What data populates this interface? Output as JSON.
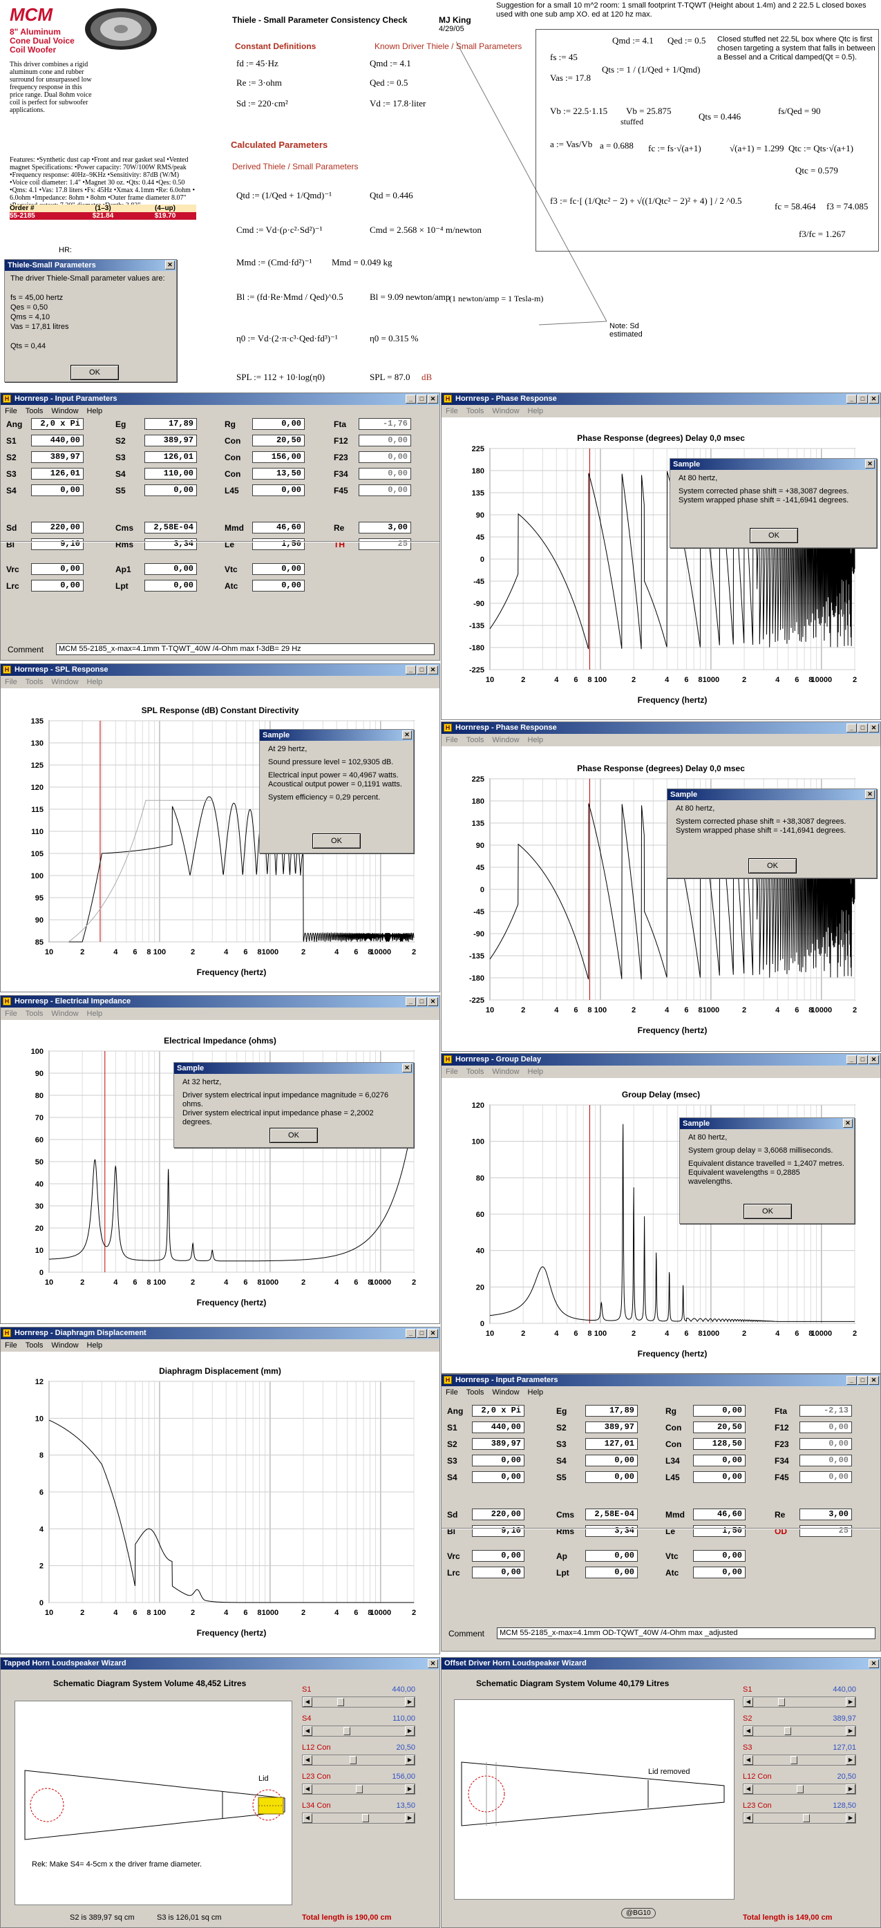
{
  "product": {
    "logo": "MCM",
    "title": "8\" Aluminum Cone Dual Voice Coil Woofer",
    "desc": "This driver combines a rigid aluminum cone and rubber surround for unsurpassed low frequency response in this price range. Dual 8ohm voice coil is perfect for subwoofer applications.",
    "features": "Features: •Synthetic dust cap •Front and rear gasket seal •Vented magnet Specifications: •Power capacity: 70W/100W RMS/peak •Frequency response: 40Hz–9KHz •Sensitivity: 87dB (W/M) •Voice coil diameter: 1.4\" •Magnet 30 oz. •Qts: 0.44 •Qes: 0.50 •Qms: 4.1 •Vas: 17.8 liters •Fs: 45Hz •Xmax 4.1mm •Re: 6.0ohm • 6.0ohm •Impedance: 8ohm • 8ohm •Outer frame diameter 8.07\" •Required cutout: 7.20\" diameter •Depth: 3.82\"",
    "table_headers": [
      "Order #",
      "(1–3)",
      "(4–up)"
    ],
    "table_row": [
      "55-2185",
      "$21.84",
      "$19.70"
    ],
    "hr": "HR:"
  },
  "ts_dialog": {
    "title": "Thiele-Small Parameters",
    "lines": [
      "The driver Thiele-Small parameter values are:",
      "fs = 45,00 hertz",
      "Qes = 0,50",
      "Qms = 4,10",
      "Vas = 17,81 litres",
      "Qts = 0,44"
    ],
    "ok": "OK"
  },
  "calc": {
    "title": "Thiele - Small Parameter Consistency Check",
    "author": "MJ King",
    "date": "4/29/05",
    "const_h": "Constant Definitions",
    "known_h": "Known Driver Thiele / Small Parameters",
    "const": [
      "fd := 45·Hz",
      "Re := 3·ohm",
      "Sd := 220·cm²"
    ],
    "known": [
      "Qmd := 4.1",
      "Qed := 0.5",
      "Vd := 17.8·liter"
    ],
    "calc_h": "Calculated Parameters",
    "derived_h": "Derived Thiele / Small Parameters",
    "f_qtd": "Qtd := (1/Qed + 1/Qmd)⁻¹",
    "r_qtd": "Qtd = 0.446",
    "f_cmd": "Cmd := Vd·(ρ·c²·Sd²)⁻¹",
    "r_cmd": "Cmd = 2.568 × 10⁻⁴ m/newton",
    "f_mmd": "Mmd := (Cmd·fd²)⁻¹",
    "r_mmd": "Mmd = 0.049 kg",
    "f_bl": "Bl := (fd·Re·Mmd / Qed)^0.5",
    "r_bl": "Bl = 9.09 newton/amp",
    "n_bl": "(1 newton/amp = 1 Tesla-m)",
    "f_eta": "η0 := Vd·(2·π·c³·Qed·fd³)⁻¹",
    "r_eta": "η0 = 0.315 %",
    "f_spl": "SPL := 112 + 10·log(η0)",
    "r_spl": "SPL = 87.0",
    "u_spl": "dB",
    "note": "Note: Sd estimated"
  },
  "suggest": {
    "text": "Suggestion for a small 10 m^2 room: 1 small footprint T-TQWT (Height about 1.4m) and 2 22.5 L closed boxes used with one sub amp XO. ed at 120 hz max.",
    "box_text": "Closed stuffed net 22.5L box where Qtc is first chosen targeting a system that falls in between a Bessel and a Critical damped(Qt = 0.5).",
    "eqs": [
      "Qmd := 4.1",
      "Qed := 0.5",
      "fs := 45",
      "Vas := 17.8",
      "Qts := 1 / (1/Qed + 1/Qmd)",
      "Vb := 22.5·1.15",
      "Vb = 25.875",
      "stuffed",
      "Qts = 0.446",
      "fs/Qed = 90",
      "a := Vas/Vb",
      "a = 0.688",
      "fc := fs·√(a+1)",
      "√(a+1) = 1.299",
      "Qtc := Qts·√(a+1)",
      "Qtc = 0.579",
      "f3 := fc·[ (1/Qtc² − 2) + √((1/Qtc² − 2)² + 4) ] / 2 ^0.5",
      "fc = 58.464",
      "f3 = 74.085",
      "f3/fc = 1.267"
    ]
  },
  "input1": {
    "title": "Hornresp - Input Parameters",
    "menu": [
      "File",
      "Tools",
      "Window",
      "Help"
    ],
    "rows": [
      [
        [
          "Ang",
          "2,0 x Pi"
        ],
        [
          "Eg",
          "17,89"
        ],
        [
          "Rg",
          "0,00"
        ],
        [
          "Fta",
          "-1,76"
        ]
      ],
      [
        [
          "S1",
          "440,00"
        ],
        [
          "S2",
          "389,97"
        ],
        [
          "Con",
          "20,50"
        ],
        [
          "F12",
          "0,00"
        ]
      ],
      [
        [
          "S2",
          "389,97"
        ],
        [
          "S3",
          "126,01"
        ],
        [
          "Con",
          "156,00"
        ],
        [
          "F23",
          "0,00"
        ]
      ],
      [
        [
          "S3",
          "126,01"
        ],
        [
          "S4",
          "110,00"
        ],
        [
          "Con",
          "13,50"
        ],
        [
          "F34",
          "0,00"
        ]
      ],
      [
        [
          "S4",
          "0,00"
        ],
        [
          "S5",
          "0,00"
        ],
        [
          "L45",
          "0,00"
        ],
        [
          "F45",
          "0,00"
        ]
      ],
      [
        [
          "Sd",
          "220,00"
        ],
        [
          "Cms",
          "2,58E-04"
        ],
        [
          "Mmd",
          "46,60"
        ],
        [
          "Re",
          "3,00"
        ]
      ],
      [
        [
          "Bl",
          "9,10"
        ],
        [
          "Rms",
          "3,34"
        ],
        [
          "Le",
          "1,50"
        ],
        [
          "TH",
          "25"
        ]
      ],
      [
        [
          "Vrc",
          "0,00"
        ],
        [
          "Ap1",
          "0,00"
        ],
        [
          "Vtc",
          "0,00"
        ]
      ],
      [
        [
          "Lrc",
          "0,00"
        ],
        [
          "Lpt",
          "0,00"
        ],
        [
          "Atc",
          "0,00"
        ]
      ]
    ],
    "comment_label": "Comment",
    "comment": "MCM 55-2185_x-max=4.1mm T-TQWT_40W /4-Ohm max f-3dB= 29 Hz"
  },
  "input2": {
    "title": "Hornresp - Input Parameters",
    "menu": [
      "File",
      "Tools",
      "Window",
      "Help"
    ],
    "rows": [
      [
        [
          "Ang",
          "2,0 x Pi"
        ],
        [
          "Eg",
          "17,89"
        ],
        [
          "Rg",
          "0,00"
        ],
        [
          "Fta",
          "-2,13"
        ]
      ],
      [
        [
          "S1",
          "440,00"
        ],
        [
          "S2",
          "389,97"
        ],
        [
          "Con",
          "20,50"
        ],
        [
          "F12",
          "0,00"
        ]
      ],
      [
        [
          "S2",
          "389,97"
        ],
        [
          "S3",
          "127,01"
        ],
        [
          "Con",
          "128,50"
        ],
        [
          "F23",
          "0,00"
        ]
      ],
      [
        [
          "S3",
          "0,00"
        ],
        [
          "S4",
          "0,00"
        ],
        [
          "L34",
          "0,00"
        ],
        [
          "F34",
          "0,00"
        ]
      ],
      [
        [
          "S4",
          "0,00"
        ],
        [
          "S5",
          "0,00"
        ],
        [
          "L45",
          "0,00"
        ],
        [
          "F45",
          "0,00"
        ]
      ],
      [
        [
          "Sd",
          "220,00"
        ],
        [
          "Cms",
          "2,58E-04"
        ],
        [
          "Mmd",
          "46,60"
        ],
        [
          "Re",
          "3,00"
        ]
      ],
      [
        [
          "Bl",
          "9,10"
        ],
        [
          "Rms",
          "3,34"
        ],
        [
          "Le",
          "1,50"
        ],
        [
          "OD",
          "25"
        ]
      ],
      [
        [
          "Vrc",
          "0,00"
        ],
        [
          "Ap",
          "0,00"
        ],
        [
          "Vtc",
          "0,00"
        ]
      ],
      [
        [
          "Lrc",
          "0,00"
        ],
        [
          "Lpt",
          "0,00"
        ],
        [
          "Atc",
          "0,00"
        ]
      ]
    ],
    "comment_label": "Comment",
    "comment": "MCM 55-2185_x-max=4.1mm OD-TQWT_40W /4-Ohm max _adjusted"
  },
  "phase1": {
    "title": "Hornresp - Phase Response",
    "menu": [
      "File",
      "Tools",
      "Window",
      "Help"
    ],
    "plot_title": "Phase Response (degrees)   Delay 0,0 msec",
    "dlg_title": "Sample",
    "dlg": [
      "At 80 hertz,",
      "System corrected phase shift = +38,3087 degrees.",
      "System wrapped phase shift = -141,6941 degrees."
    ],
    "ok": "OK"
  },
  "phase2": {
    "title": "Hornresp - Phase Response",
    "menu": [
      "File",
      "Tools",
      "Window",
      "Help"
    ],
    "plot_title": "Phase Response (degrees)   Delay 0,0 msec",
    "dlg_title": "Sample",
    "dlg": [
      "At 80 hertz,",
      "System corrected phase shift = +38,3087 degrees.",
      "System wrapped phase shift = -141,6941 degrees."
    ],
    "ok": "OK"
  },
  "spl": {
    "title": "Hornresp - SPL Response",
    "menu": [
      "File",
      "Tools",
      "Window",
      "Help"
    ],
    "plot_title": "SPL Response (dB)   Constant Directivity",
    "dlg_title": "Sample",
    "dlg": [
      "At 29 hertz,",
      "Sound pressure level = 102,9305 dB.",
      "Electrical input power = 40,4967 watts.",
      "Acoustical output power = 0,1191 watts.",
      "System efficiency = 0,29 percent."
    ],
    "ok": "OK"
  },
  "imp": {
    "title": "Hornresp - Electrical Impedance",
    "menu": [
      "File",
      "Tools",
      "Window",
      "Help"
    ],
    "plot_title": "Electrical Impedance (ohms)",
    "dlg_title": "Sample",
    "dlg": [
      "At 32 hertz,",
      "Driver system electrical input impedance magnitude = 6,0276 ohms.",
      "Driver system electrical input impedance phase = 2,2002 degrees."
    ],
    "ok": "OK"
  },
  "gd": {
    "title": "Hornresp - Group Delay",
    "menu": [
      "File",
      "Tools",
      "Window",
      "Help"
    ],
    "plot_title": "Group Delay (msec)",
    "dlg_title": "Sample",
    "dlg": [
      "At 80 hertz,",
      "System group delay = 3,6068 milliseconds.",
      "Equivalent distance travelled = 1,2407 metres.",
      "Equivalent wavelengths = 0,2885 wavelengths."
    ],
    "ok": "OK"
  },
  "disp": {
    "title": "Hornresp - Diaphragm Displacement",
    "menu": [
      "File",
      "Tools",
      "Window",
      "Help"
    ],
    "plot_title": "Diaphragm Displacement (mm)"
  },
  "xlabel": "Frequency (hertz)",
  "wiz1": {
    "title": "Tapped Horn Loudspeaker Wizard",
    "schem": "Schematic Diagram   System Volume 48,452 Litres",
    "lid": "Lid",
    "rek": "Rek: Make S4= 4-5cm  x  the driver frame diameter.",
    "foot1": "S2 is 389,97 sq cm",
    "foot2": "S3 is 126,01 sq cm",
    "total": "Total length is 190,00 cm",
    "sliders": [
      [
        "S1",
        "440,00"
      ],
      [
        "S4",
        "110,00"
      ],
      [
        "L12 Con",
        "20,50"
      ],
      [
        "L23 Con",
        "156,00"
      ],
      [
        "L34 Con",
        "13,50"
      ]
    ]
  },
  "wiz2": {
    "title": "Offset Driver Horn Loudspeaker Wizard",
    "schem": "Schematic Diagram   System Volume 40,179 Litres",
    "lid": "Lid removed",
    "foot": "@BG10",
    "total": "Total length is 149,00 cm",
    "sliders": [
      [
        "S1",
        "440,00"
      ],
      [
        "S2",
        "389,97"
      ],
      [
        "S3",
        "127,01"
      ],
      [
        "L12 Con",
        "20,50"
      ],
      [
        "L23 Con",
        "128,50"
      ]
    ]
  },
  "chart_data": [
    {
      "type": "line",
      "title": "Phase Response (degrees)   Delay 0,0 msec",
      "xlabel": "Frequency (hertz)",
      "ylim": [
        -225,
        225
      ],
      "yticks": [
        225,
        180,
        135,
        90,
        45,
        0,
        -45,
        -90,
        -135,
        -180,
        -225
      ],
      "xticks": [
        "10",
        "2",
        "4",
        "6",
        "8",
        "100",
        "2",
        "4",
        "6",
        "8",
        "1000",
        "2",
        "4",
        "6",
        "8",
        "10000",
        "2"
      ],
      "xscale": "log",
      "xlim": [
        10,
        20000
      ],
      "marker_hz": 80
    },
    {
      "type": "line",
      "title": "SPL Response (dB)   Constant Directivity",
      "xlabel": "Frequency (hertz)",
      "ylim": [
        85,
        135
      ],
      "yticks": [
        135,
        130,
        125,
        120,
        115,
        110,
        105,
        100,
        95,
        90,
        85
      ],
      "xscale": "log",
      "xlim": [
        10,
        20000
      ],
      "marker_hz": 29
    },
    {
      "type": "line",
      "title": "Electrical Impedance (ohms)",
      "xlabel": "Frequency (hertz)",
      "ylim": [
        0,
        100
      ],
      "yticks": [
        100,
        90,
        80,
        70,
        60,
        50,
        40,
        30,
        20,
        10,
        0
      ],
      "xscale": "log",
      "xlim": [
        10,
        20000
      ],
      "marker_hz": 32
    },
    {
      "type": "line",
      "title": "Group Delay (msec)",
      "xlabel": "Frequency (hertz)",
      "ylim": [
        0,
        120
      ],
      "yticks": [
        120,
        100,
        80,
        60,
        40,
        20,
        0
      ],
      "xscale": "log",
      "xlim": [
        10,
        20000
      ],
      "marker_hz": 80
    },
    {
      "type": "line",
      "title": "Diaphragm Displacement (mm)",
      "xlabel": "Frequency (hertz)",
      "ylim": [
        0,
        12
      ],
      "yticks": [
        12,
        10,
        8,
        6,
        4,
        2,
        0
      ],
      "xscale": "log",
      "xlim": [
        10,
        20000
      ]
    }
  ],
  "colors": {
    "title_bar": "#0a246a",
    "panel": "#d4d0c8",
    "red_label": "#b03020",
    "blue_value": "#3050c0",
    "marker": "#c00000"
  }
}
